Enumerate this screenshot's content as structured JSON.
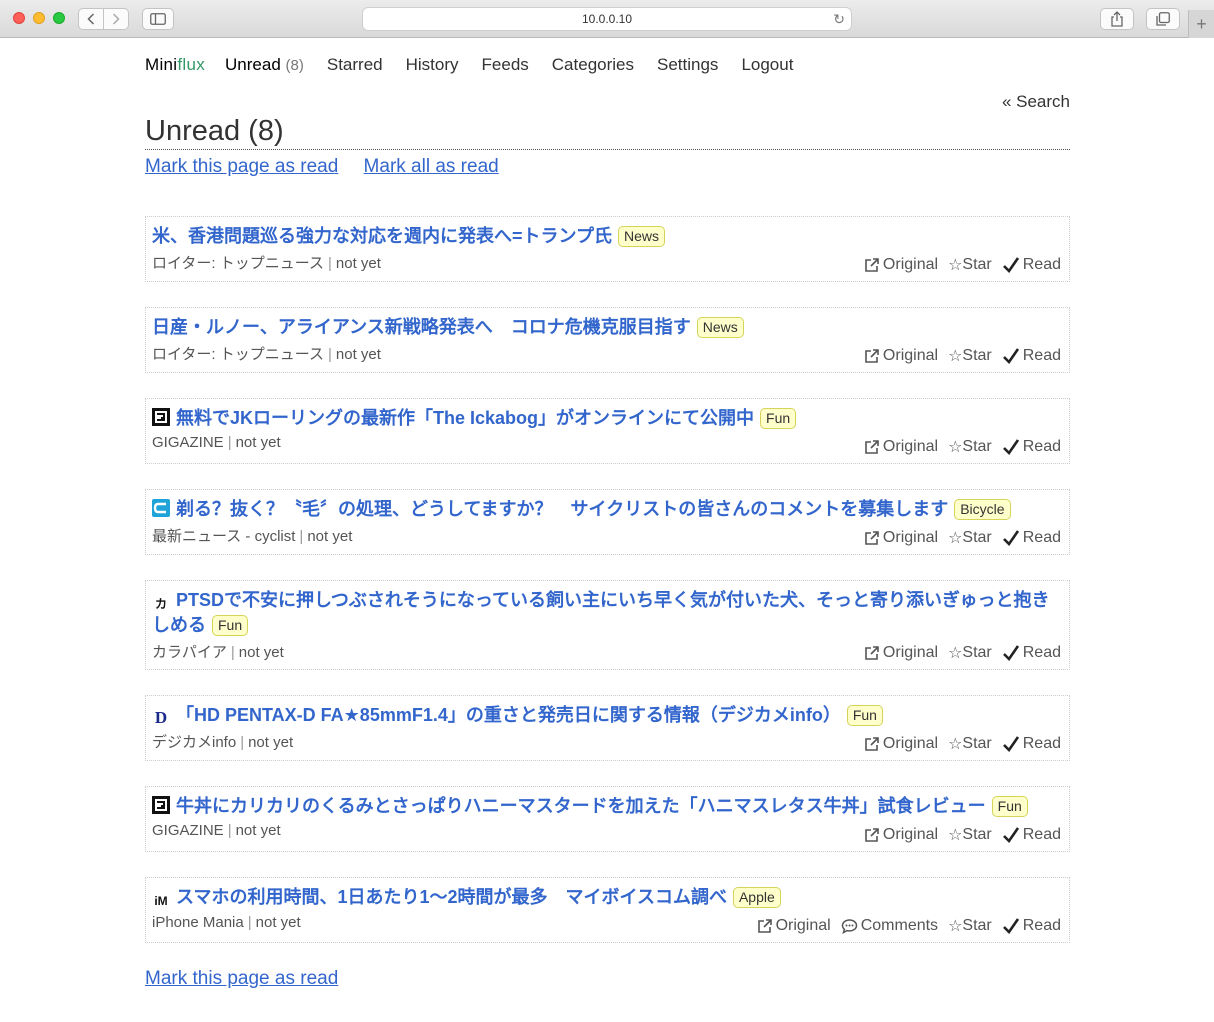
{
  "browser": {
    "url": "10.0.0.10"
  },
  "header": {
    "logo_part1": "Mini",
    "logo_part2": "flux",
    "menu": [
      {
        "label": "Unread",
        "count": "(8)"
      },
      {
        "label": "Starred"
      },
      {
        "label": "History"
      },
      {
        "label": "Feeds"
      },
      {
        "label": "Categories"
      },
      {
        "label": "Settings"
      },
      {
        "label": "Logout"
      }
    ],
    "search_toggle": "« Search"
  },
  "page": {
    "title": "Unread (8)",
    "mark_page_read": "Mark this page as read",
    "mark_all_read": "Mark all as read",
    "bottom_mark_page_read": "Mark this page as read"
  },
  "actions": {
    "original": "Original",
    "comments": "Comments",
    "star": "Star",
    "read": "Read"
  },
  "entries": [
    {
      "title": "米、香港問題巡る強力な対応を週内に発表へ=トランプ氏",
      "category": "News",
      "feed": "ロイター: トップニュース",
      "date": "not yet",
      "icon": "none"
    },
    {
      "title": "日産・ルノー、アライアンス新戦略発表へ　コロナ危機克服目指す",
      "category": "News",
      "feed": "ロイター: トップニュース",
      "date": "not yet",
      "icon": "none"
    },
    {
      "title": "無料でJKローリングの最新作「The Ickabog」がオンラインにて公開中",
      "category": "Fun",
      "feed": "GIGAZINE",
      "date": "not yet",
      "icon": "gigazine-icon"
    },
    {
      "title": "剃る？抜く？〝毛〞の処理、どうしてますか？　サイクリストの皆さんのコメントを募集します",
      "category": "Bicycle",
      "feed": "最新ニュース - cyclist",
      "date": "not yet",
      "icon": "cyclist-icon"
    },
    {
      "title": "PTSDで不安に押しつぶされそうになっている飼い主にいち早く気が付いた犬、そっと寄り添いぎゅっと抱きしめる",
      "category": "Fun",
      "feed": "カラパイア",
      "date": "not yet",
      "icon": "karapaia-icon"
    },
    {
      "title": "「HD PENTAX-D FA★85mmF1.4」の重さと発売日に関する情報（デジカメinfo）",
      "category": "Fun",
      "feed": "デジカメinfo",
      "date": "not yet",
      "icon": "digicame-icon"
    },
    {
      "title": "牛丼にカリカリのくるみとさっぱりハニーマスタードを加えた「ハニマスレタス牛丼」試食レビュー",
      "category": "Fun",
      "feed": "GIGAZINE",
      "date": "not yet",
      "icon": "gigazine-icon"
    },
    {
      "title": "スマホの利用時間、1日あたり1〜2時間が最多　マイボイスコム調べ",
      "category": "Apple",
      "feed": "iPhone Mania",
      "date": "not yet",
      "icon": "iphonemania-icon"
    }
  ]
}
